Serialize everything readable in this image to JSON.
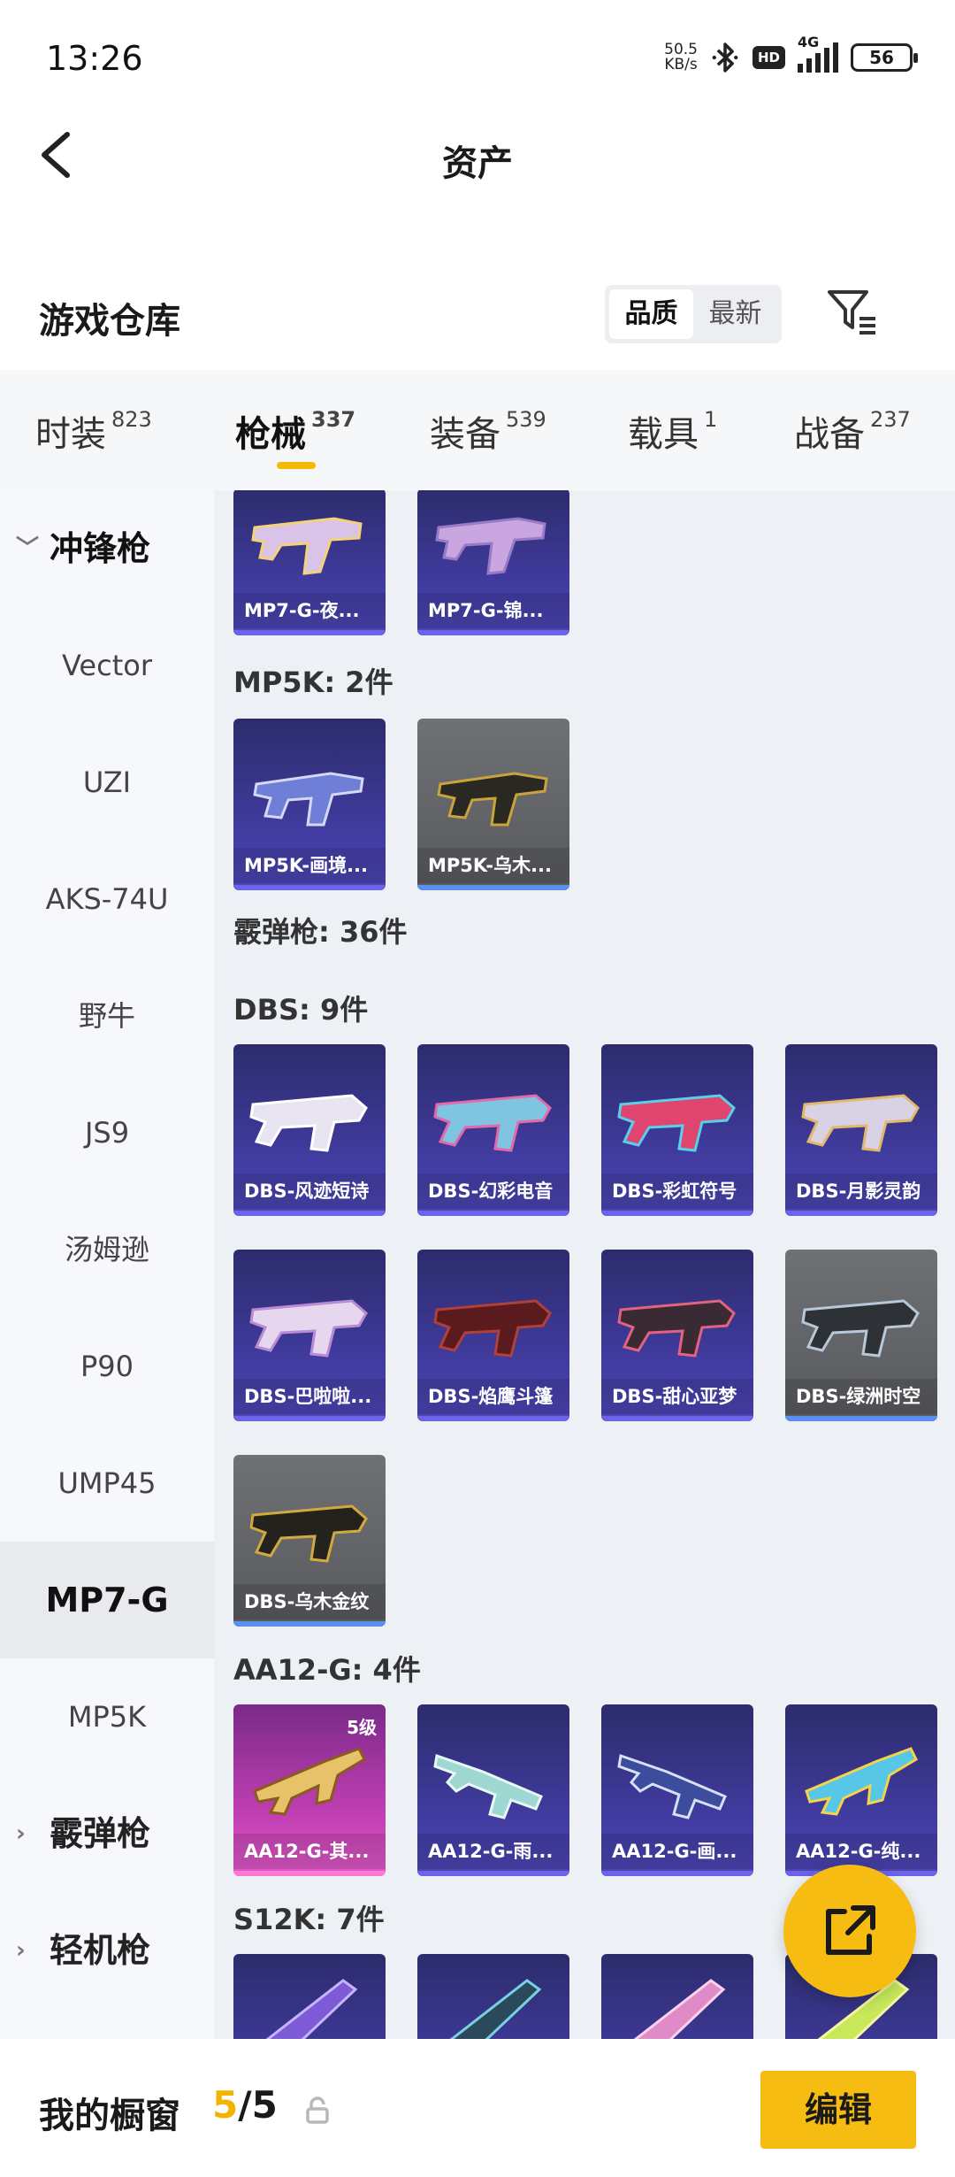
{
  "status": {
    "time": "13:26",
    "net_speed_value": "50.5",
    "net_speed_unit": "KB/s",
    "hd": "HD",
    "network": "4G",
    "battery": "56"
  },
  "header": {
    "title": "资产"
  },
  "warehouse": {
    "title": "游戏仓库",
    "sort": {
      "quality": "品质",
      "latest": "最新"
    }
  },
  "tabs": [
    {
      "label": "时装",
      "count": "823"
    },
    {
      "label": "枪械",
      "count": "337"
    },
    {
      "label": "装备",
      "count": "539"
    },
    {
      "label": "载具",
      "count": "1"
    },
    {
      "label": "战备",
      "count": "237"
    }
  ],
  "sidebar": {
    "groups": [
      {
        "label": "冲锋枪",
        "state": "expanded"
      },
      {
        "label": "霰弹枪",
        "state": "collapsed"
      },
      {
        "label": "轻机枪",
        "state": "collapsed"
      }
    ],
    "items": [
      "Vector",
      "UZI",
      "AKS-74U",
      "野牛",
      "JS9",
      "汤姆逊",
      "P90",
      "UMP45",
      "MP7-G",
      "MP5K"
    ],
    "selected": "MP7-G"
  },
  "content": {
    "top_row": [
      "MP7-G-夜...",
      "MP7-G-锦..."
    ],
    "mp5k_header": "MP5K: 2件",
    "mp5k": [
      "MP5K-画境...",
      "MP5K-乌木..."
    ],
    "shotgun_header": "霰弹枪: 36件",
    "dbs_header": "DBS: 9件",
    "dbs": [
      "DBS-风迹短诗",
      "DBS-幻彩电音",
      "DBS-彩虹符号",
      "DBS-月影灵韵",
      "DBS-巴啦啦...",
      "DBS-焰鹰斗篷",
      "DBS-甜心亚梦",
      "DBS-绿洲时空",
      "DBS-乌木金纹"
    ],
    "aa12_header": "AA12-G: 4件",
    "aa12": [
      "AA12-G-其...",
      "AA12-G-雨...",
      "AA12-G-画...",
      "AA12-G-纯..."
    ],
    "aa12_level": "5级",
    "s12k_header": "S12K: 7件"
  },
  "bottom": {
    "showcase_label": "我的橱窗",
    "count_current": "5",
    "count_total": "/5",
    "edit": "编辑"
  },
  "colors": {
    "accent": "#f7bc12",
    "card_purple": "#3f3a9b",
    "card_gray": "#5b5c60",
    "card_pink": "#c23fb4"
  }
}
